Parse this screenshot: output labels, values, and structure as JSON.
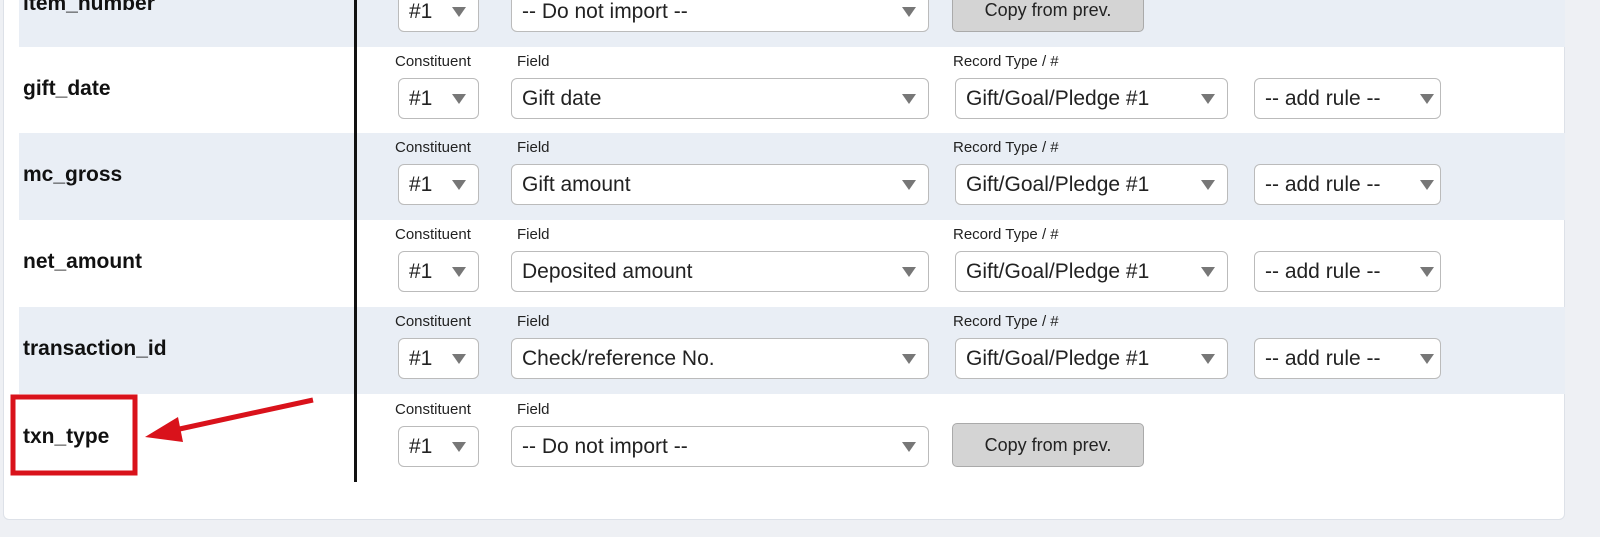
{
  "labels": {
    "constituent": "Constituent",
    "field": "Field",
    "record_type": "Record Type / #"
  },
  "rows": [
    {
      "name": "item_number",
      "constituent": "#1",
      "field": "-- Do not import --",
      "action": "Copy from prev.",
      "shaded": true,
      "partial": true
    },
    {
      "name": "gift_date",
      "constituent": "#1",
      "field": "Gift date",
      "record_type": "Gift/Goal/Pledge #1",
      "rule": "-- add rule --"
    },
    {
      "name": "mc_gross",
      "constituent": "#1",
      "field": "Gift amount",
      "record_type": "Gift/Goal/Pledge #1",
      "rule": "-- add rule --",
      "shaded": true
    },
    {
      "name": "net_amount",
      "constituent": "#1",
      "field": "Deposited amount",
      "record_type": "Gift/Goal/Pledge #1",
      "rule": "-- add rule --"
    },
    {
      "name": "transaction_id",
      "constituent": "#1",
      "field": "Check/reference No.",
      "record_type": "Gift/Goal/Pledge #1",
      "rule": "-- add rule --",
      "shaded": true
    },
    {
      "name": "txn_type",
      "constituent": "#1",
      "field": "-- Do not import --",
      "action": "Copy from prev.",
      "highlighted": true
    }
  ],
  "colors": {
    "highlight": "#d9121b",
    "row_shade": "#e9eef5"
  }
}
